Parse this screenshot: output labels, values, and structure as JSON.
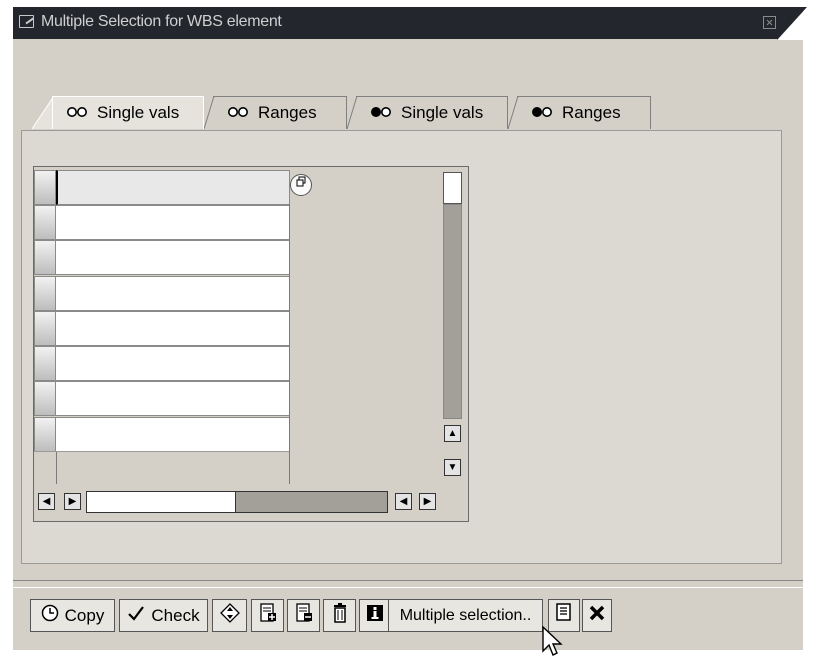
{
  "window": {
    "title": "Multiple Selection for WBS element"
  },
  "tabs": [
    {
      "label": "Single vals",
      "icon": "green-circles-icon",
      "active": true
    },
    {
      "label": "Ranges",
      "icon": "green-circles-icon",
      "active": false
    },
    {
      "label": "Single vals",
      "icon": "red-circles-icon",
      "active": false
    },
    {
      "label": "Ranges",
      "icon": "red-circles-icon",
      "active": false
    }
  ],
  "grid": {
    "rows": [
      "",
      "",
      "",
      "",
      "",
      "",
      "",
      ""
    ]
  },
  "toolbar": {
    "copy_label": "Copy",
    "check_label": "Check",
    "multiple_selection_label": "Multiple selection.."
  }
}
